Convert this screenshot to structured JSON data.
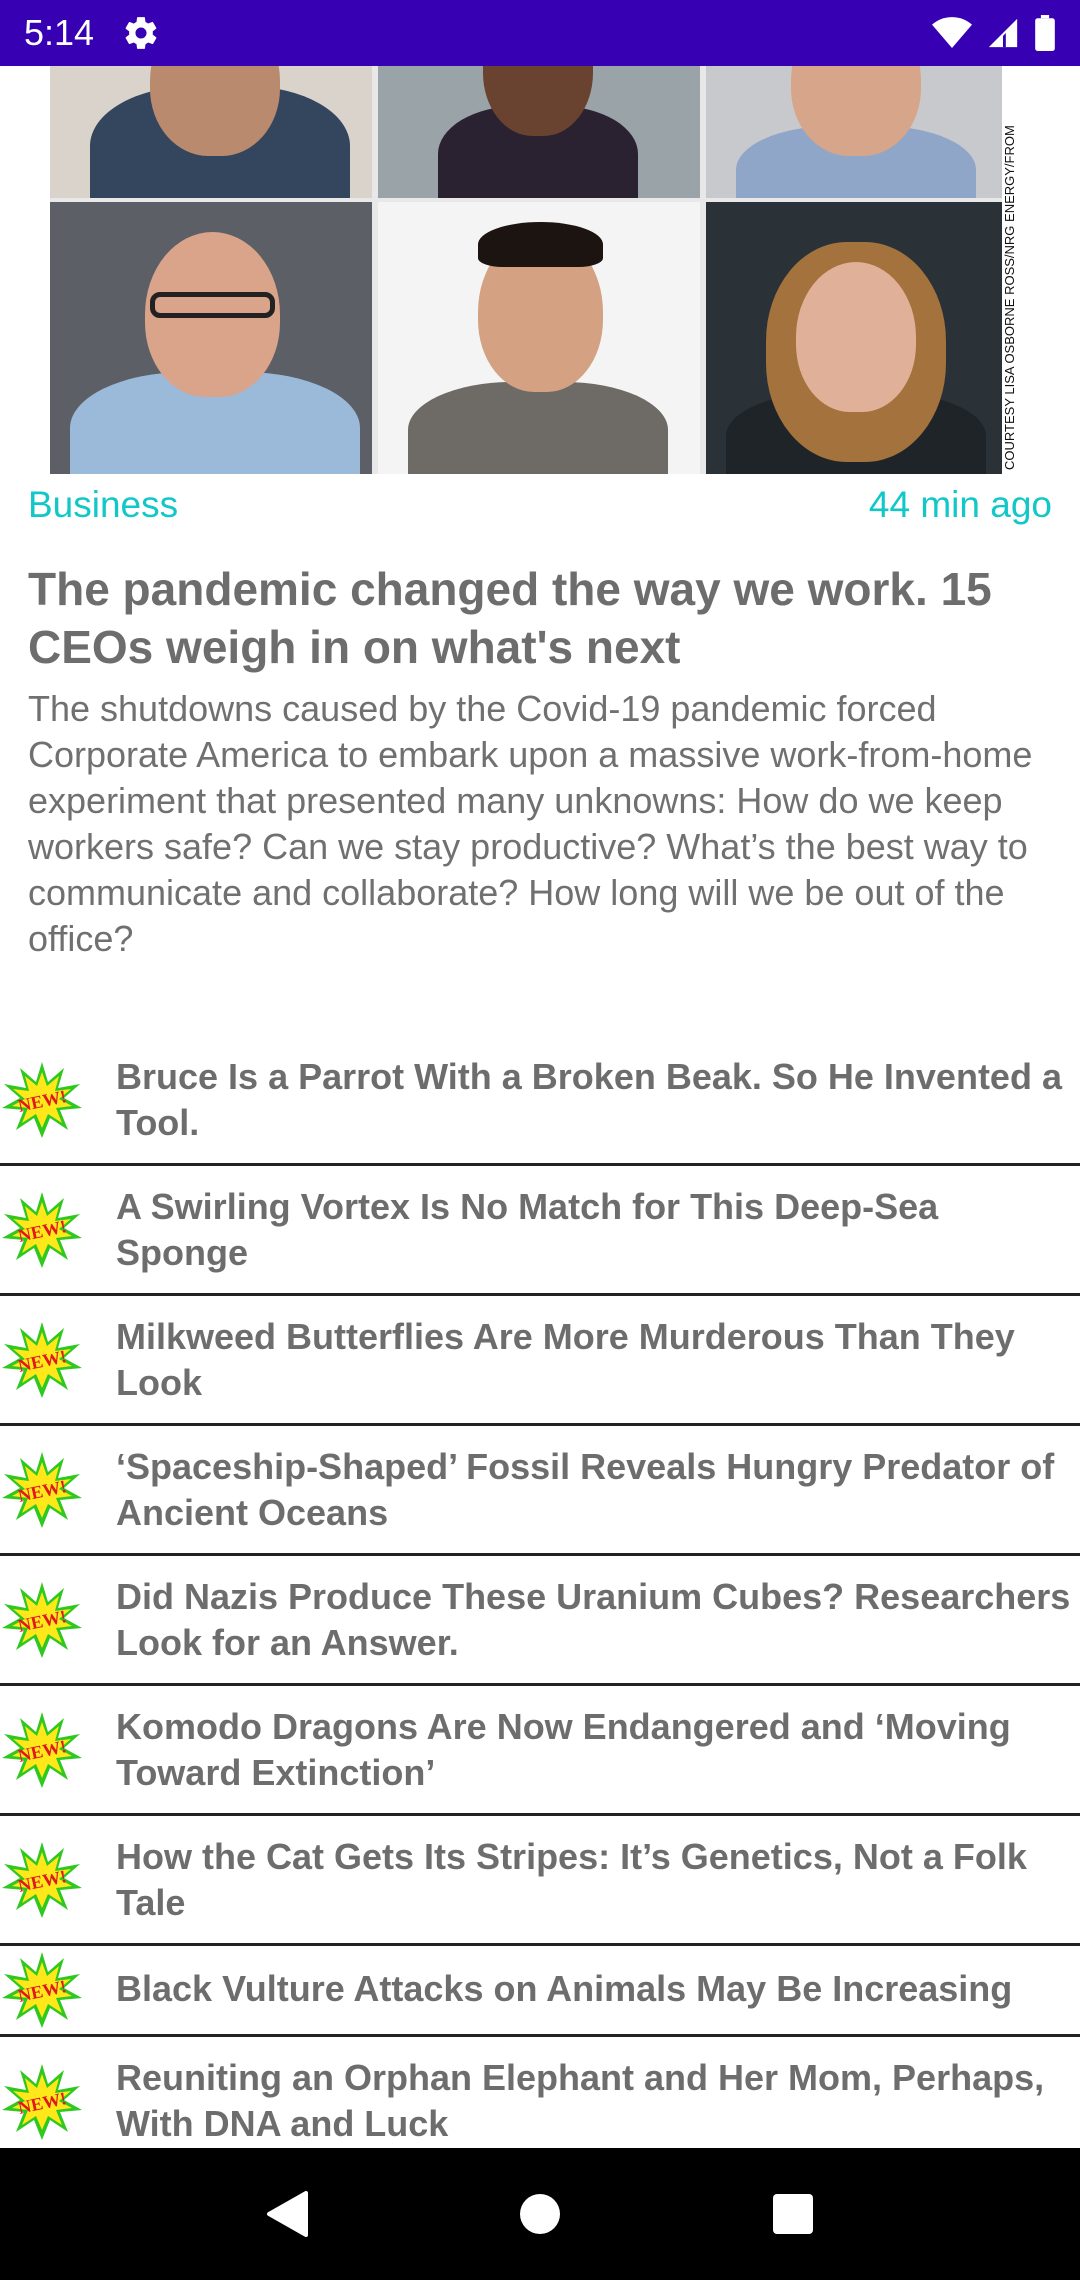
{
  "status_bar": {
    "time": "5:14",
    "settings_icon": "gear-icon",
    "wifi_icon": "wifi-icon",
    "signal_icon": "signal-icon",
    "battery_icon": "battery-icon"
  },
  "featured": {
    "image_credit": "COURTESY LISA OSBORNE ROSS/NRG ENERGY/FROM",
    "category": "Business",
    "time_ago": "44 min ago",
    "title": "The pandemic changed the way we work. 15 CEOs weigh in on what's next",
    "summary": "The shutdowns caused by the Covid-19 pandemic forced Corporate America to embark upon a massive work-from-home experiment that presented many unknowns: How do we keep workers safe? Can we stay productive? What’s the best way to communicate and collaborate? How long will we be out of the office?"
  },
  "news": {
    "badge_text": "NEW!",
    "items": [
      {
        "title": "Bruce Is a Parrot With a Broken Beak. So He Invented a Tool."
      },
      {
        "title": "A Swirling Vortex Is No Match for This Deep-Sea Sponge"
      },
      {
        "title": "Milkweed Butterflies Are More Murderous Than They Look"
      },
      {
        "title": "‘Spaceship-Shaped’ Fossil Reveals Hungry Predator of Ancient Oceans"
      },
      {
        "title": "Did Nazis Produce These Uranium Cubes? Researchers Look for an Answer."
      },
      {
        "title": "Komodo Dragons Are Now Endangered and ‘Moving Toward Extinction’"
      },
      {
        "title": "How the Cat Gets Its Stripes: It’s Genetics, Not a Folk Tale"
      },
      {
        "title": "Black Vulture Attacks on Animals May Be Increasing"
      },
      {
        "title": "Reuniting an Orphan Elephant and Her Mom, Perhaps, With DNA and Luck"
      }
    ]
  },
  "nav_bar": {
    "back_icon": "back-triangle-icon",
    "home_icon": "home-circle-icon",
    "recents_icon": "recents-square-icon"
  },
  "colors": {
    "status_bar": "#3700b3",
    "accent": "#12c7c7",
    "text_gray": "#6d6d6d"
  }
}
